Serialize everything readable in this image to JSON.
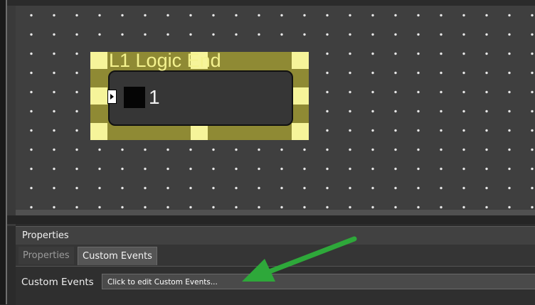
{
  "workspace": {
    "block": {
      "title": "L1  Logic End",
      "number": "1"
    }
  },
  "properties_panel": {
    "title": "Properties",
    "tabs": [
      {
        "label": "Properties",
        "active": false
      },
      {
        "label": "Custom Events",
        "active": true
      }
    ],
    "field": {
      "label": "Custom Events",
      "value": "Click to edit Custom Events..."
    }
  },
  "annotation": {
    "arrow_color": "#2ea83a",
    "icon": "arrow-pointer-icon"
  },
  "colors": {
    "selection_frame": "#8f8a34",
    "selection_handle": "#f6f49a",
    "canvas": "#3f3f3f",
    "grid_dot": "#e8e8e8"
  }
}
